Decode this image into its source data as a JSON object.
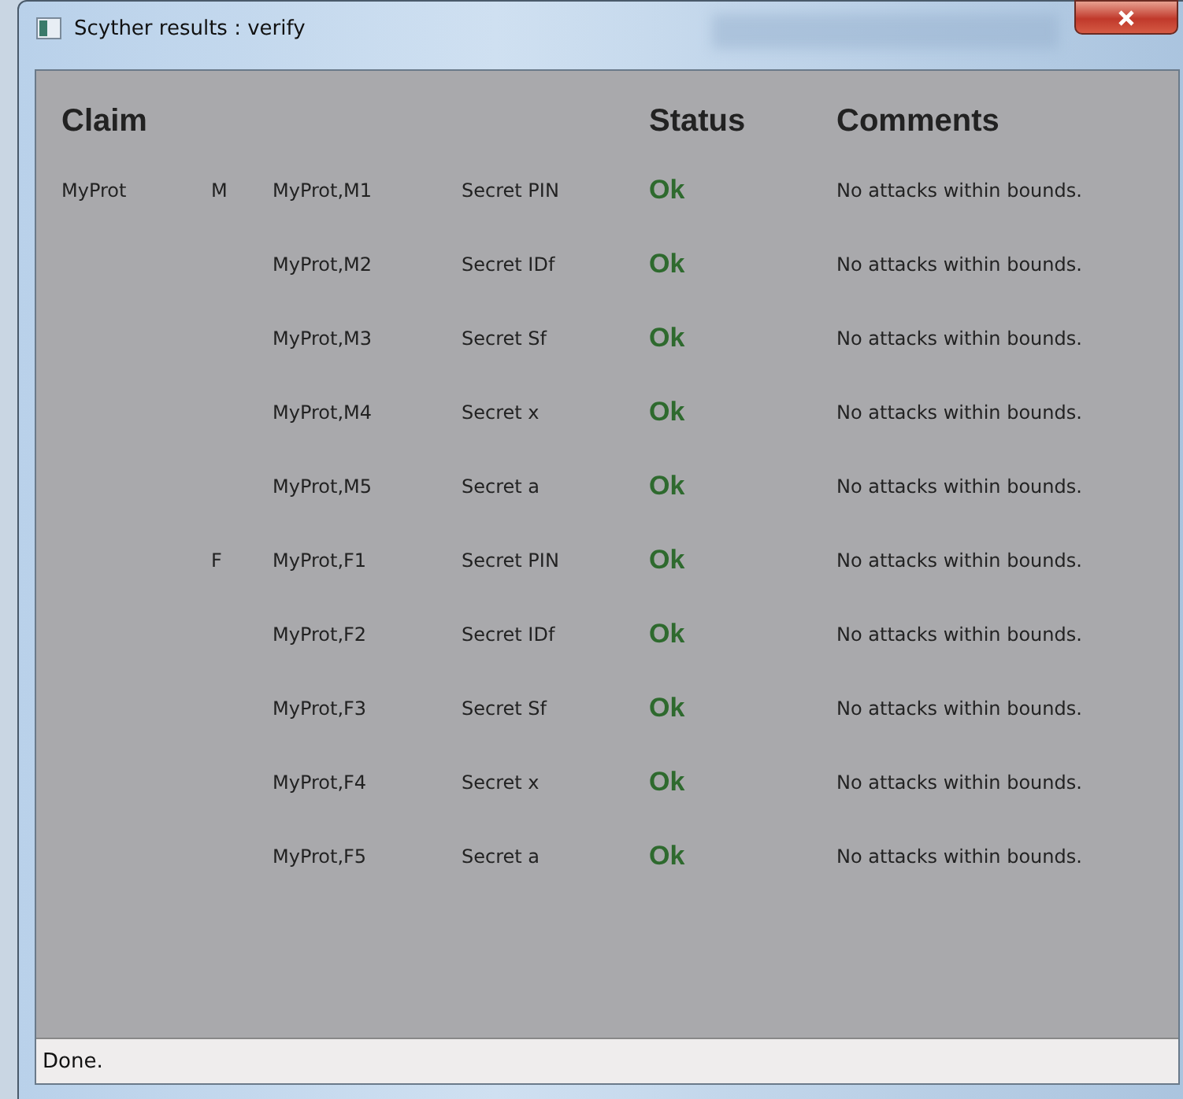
{
  "window": {
    "title": "Scyther results : verify"
  },
  "table": {
    "columns": [
      "Claim",
      "Status",
      "Comments"
    ],
    "rows": [
      {
        "protocol": "MyProt",
        "role": "M",
        "claim_id": "MyProt,M1",
        "claim": "Secret PIN",
        "status": "Ok",
        "comment": "No attacks within bounds."
      },
      {
        "claim_id": "MyProt,M2",
        "claim": "Secret IDf",
        "status": "Ok",
        "comment": "No attacks within bounds."
      },
      {
        "claim_id": "MyProt,M3",
        "claim": "Secret Sf",
        "status": "Ok",
        "comment": "No attacks within bounds."
      },
      {
        "claim_id": "MyProt,M4",
        "claim": "Secret x",
        "status": "Ok",
        "comment": "No attacks within bounds."
      },
      {
        "claim_id": "MyProt,M5",
        "claim": "Secret a",
        "status": "Ok",
        "comment": "No attacks within bounds."
      },
      {
        "role": "F",
        "claim_id": "MyProt,F1",
        "claim": "Secret PIN",
        "status": "Ok",
        "comment": "No attacks within bounds."
      },
      {
        "claim_id": "MyProt,F2",
        "claim": "Secret IDf",
        "status": "Ok",
        "comment": "No attacks within bounds."
      },
      {
        "claim_id": "MyProt,F3",
        "claim": "Secret Sf",
        "status": "Ok",
        "comment": "No attacks within bounds."
      },
      {
        "claim_id": "MyProt,F4",
        "claim": "Secret x",
        "status": "Ok",
        "comment": "No attacks within bounds."
      },
      {
        "claim_id": "MyProt,F5",
        "claim": "Secret a",
        "status": "Ok",
        "comment": "No attacks within bounds."
      }
    ]
  },
  "status_bar": "Done."
}
